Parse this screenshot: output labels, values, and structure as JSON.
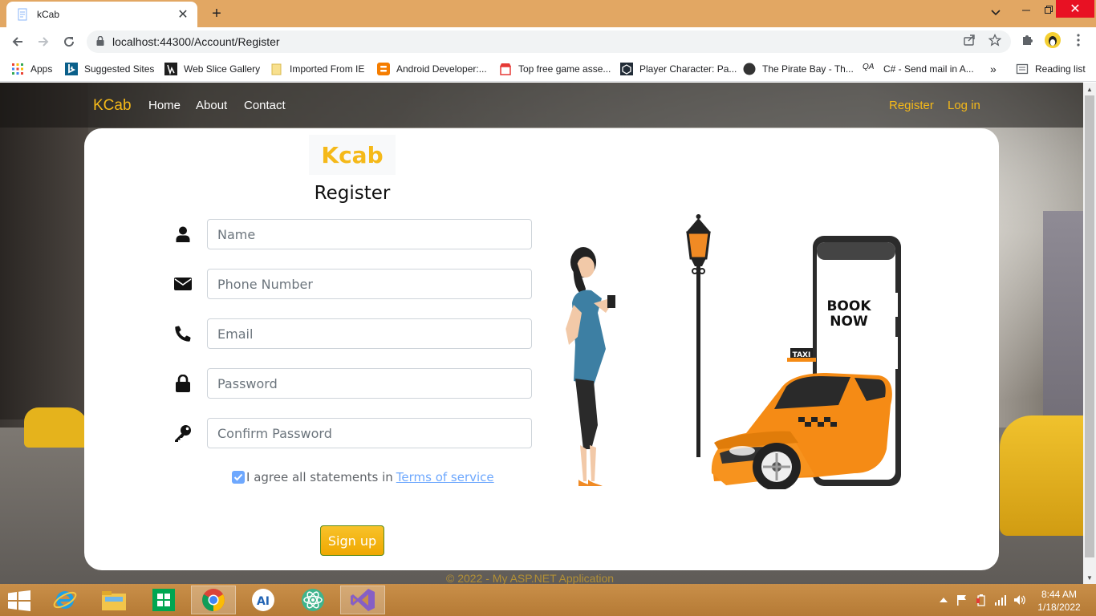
{
  "browser": {
    "tab_title": "kCab",
    "url": "localhost:44300/Account/Register",
    "bookmarks": [
      {
        "label": "Apps",
        "icon": "apps-grid-icon"
      },
      {
        "label": "Suggested Sites",
        "icon": "bing-icon"
      },
      {
        "label": "Web Slice Gallery",
        "icon": "web-slice-icon"
      },
      {
        "label": "Imported From IE",
        "icon": "folder-icon"
      },
      {
        "label": "Android Developer:...",
        "icon": "blogger-icon"
      },
      {
        "label": "Top free game asse...",
        "icon": "store-icon"
      },
      {
        "label": "Player Character: Pa...",
        "icon": "unity-icon"
      },
      {
        "label": "The Pirate Bay - Th...",
        "icon": "pirate-icon"
      },
      {
        "label": "C# - Send mail in A...",
        "icon": "qa-icon"
      }
    ],
    "reading_list": "Reading list",
    "more_bookmarks": "»"
  },
  "site": {
    "brand": "KCab",
    "nav": [
      "Home",
      "About",
      "Contact"
    ],
    "register_link": "Register",
    "login_link": "Log in",
    "footer": "© 2022 - My ASP.NET Application"
  },
  "form": {
    "logo": "Kcab",
    "title": "Register",
    "fields": [
      {
        "placeholder": "Name",
        "icon": "user-icon"
      },
      {
        "placeholder": "Phone Number",
        "icon": "envelope-icon"
      },
      {
        "placeholder": "Email",
        "icon": "phone-icon"
      },
      {
        "placeholder": "Password",
        "icon": "lock-icon"
      },
      {
        "placeholder": "Confirm Password",
        "icon": "key-icon"
      }
    ],
    "agree_text": "I agree all statements in",
    "terms_link": "Terms of service",
    "agree_checked": true,
    "submit": "Sign up"
  },
  "illustration": {
    "phone_text_1": "BOOK",
    "phone_text_2": "NOW",
    "taxi_sign": "TAXI"
  },
  "taskbar": {
    "time": "8:44 AM",
    "date": "1/18/2022"
  },
  "colors": {
    "accent": "#f5b919",
    "tabstrip": "#e2a763",
    "link": "#6ea8fe"
  }
}
